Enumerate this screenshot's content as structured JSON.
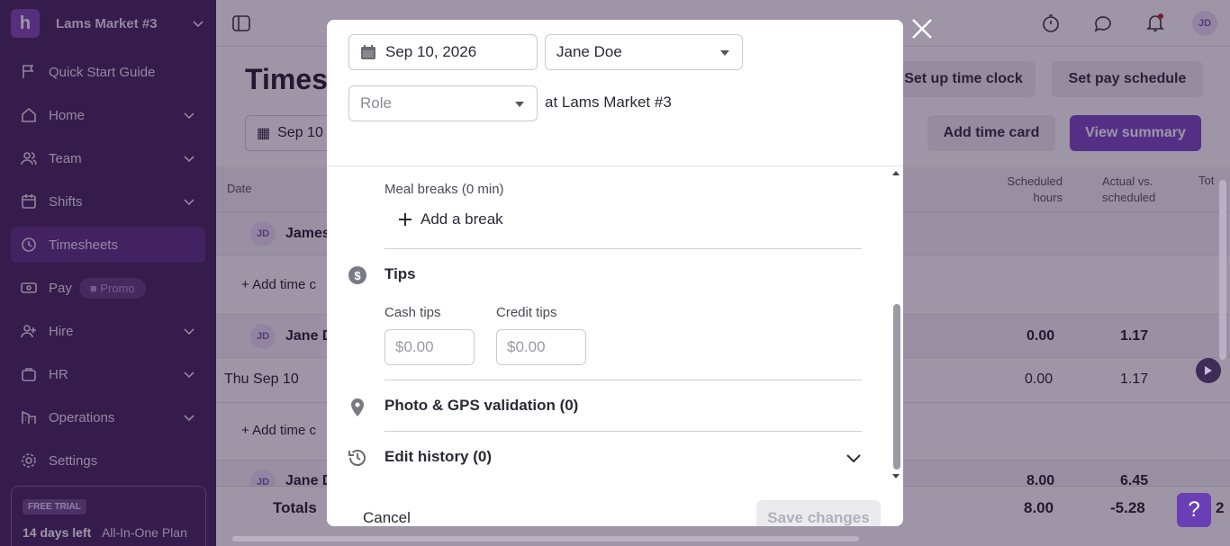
{
  "sidebar": {
    "logo_letter": "h",
    "location": "Lams Market #3",
    "items": [
      {
        "label": "Quick Start Guide"
      },
      {
        "label": "Home"
      },
      {
        "label": "Team"
      },
      {
        "label": "Shifts"
      },
      {
        "label": "Timesheets"
      },
      {
        "label": "Pay",
        "badge": "Promo"
      },
      {
        "label": "Hire"
      },
      {
        "label": "HR"
      },
      {
        "label": "Operations"
      },
      {
        "label": "Settings"
      }
    ],
    "trial": {
      "badge": "FREE TRIAL",
      "days": "14 days left",
      "plan": "All-In-One Plan"
    }
  },
  "header": {
    "user_initials": "JD"
  },
  "page": {
    "title": "Timesh",
    "buttons": {
      "setup_clock": "Set up time clock",
      "pay_schedule": "Set pay schedule",
      "add_time_card": "Add time card",
      "view_summary": "View summary"
    },
    "date_filter": "Sep 10",
    "columns": {
      "date": "Date",
      "scheduled": "Scheduled hours",
      "scheduled_l1": "Scheduled",
      "scheduled_l2": "hours",
      "actual_l1": "Actual vs.",
      "actual_l2": "scheduled",
      "total": "Tot"
    },
    "rows": {
      "james": {
        "initials": "JD",
        "name": "James"
      },
      "add1": "Add time c",
      "jane": {
        "initials": "JD",
        "name": "Jane D",
        "scheduled": "0.00",
        "actual": "1.17"
      },
      "day": {
        "date": "Thu Sep 10",
        "scheduled": "0.00",
        "actual": "1.17"
      },
      "add2": "Add time c",
      "partial": {
        "initials": "JD",
        "name": "Jane D",
        "scheduled": "8.00",
        "actual": "6.45"
      }
    },
    "totals": {
      "label": "Totals",
      "scheduled": "8.00",
      "actual": "-5.28",
      "total": "2"
    }
  },
  "modal": {
    "date": "Sep 10, 2026",
    "employee": "Jane Doe",
    "role_placeholder": "Role",
    "at_location": "at Lams Market #3",
    "meal_breaks_label": "Meal breaks (0 min)",
    "add_break": "Add a break",
    "tips_title": "Tips",
    "cash_tips_label": "Cash tips",
    "credit_tips_label": "Credit tips",
    "cash_placeholder": "$0.00",
    "credit_placeholder": "$0.00",
    "photo_gps": "Photo & GPS validation (0)",
    "edit_history": "Edit history (0)",
    "cancel": "Cancel",
    "save": "Save changes"
  },
  "help_label": "?"
}
